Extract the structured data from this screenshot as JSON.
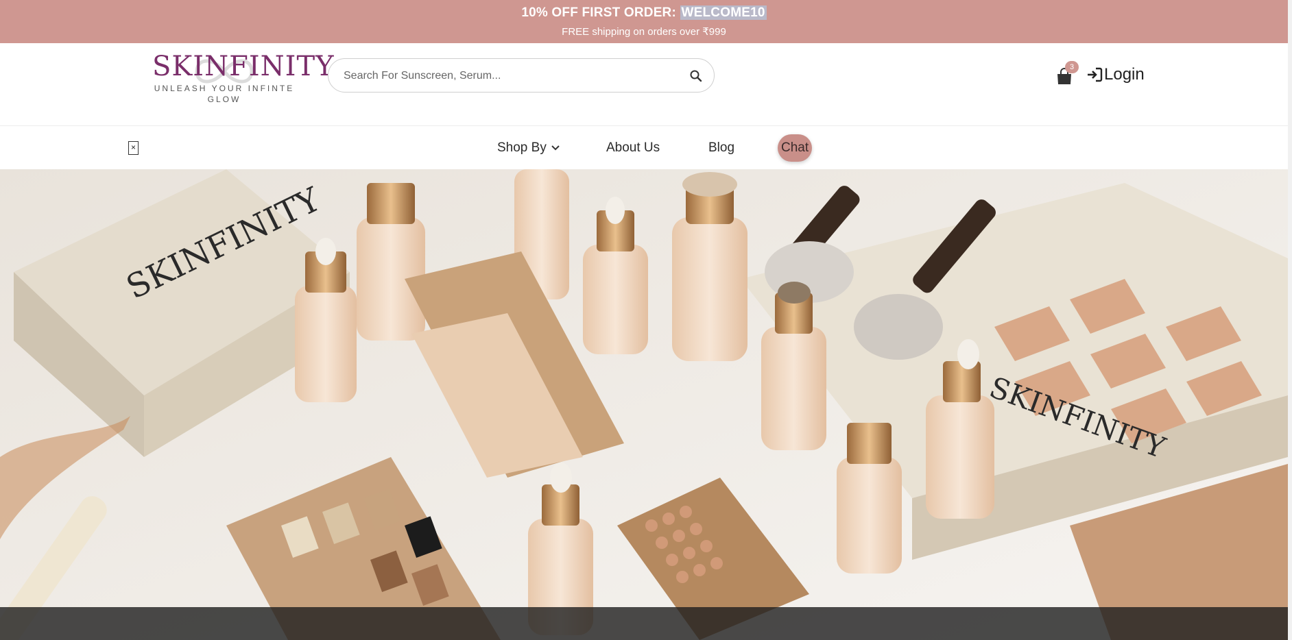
{
  "announcement": {
    "offer_prefix": "10% OFF FIRST ORDER: ",
    "offer_code": "WELCOME10",
    "shipping": "FREE shipping on orders over ₹999"
  },
  "brand": {
    "name": "SKINFINITY",
    "tagline_1": "UNLEASH YOUR INFINTE",
    "tagline_2": "GLOW",
    "color": "#7a2e6a"
  },
  "search": {
    "placeholder": "Search For Sunscreen, Serum...",
    "value": ""
  },
  "cart": {
    "count": "3"
  },
  "login": {
    "label": "Login"
  },
  "nav": {
    "close_label": "×",
    "items": [
      {
        "label": "Shop By",
        "icon": "chevron-down-icon"
      },
      {
        "label": "About Us"
      },
      {
        "label": "Blog"
      },
      {
        "label": "Chat"
      }
    ]
  },
  "hero": {
    "box_label_1": "SKINFINITY",
    "box_label_2": "SKINFINITY"
  },
  "colors": {
    "accent": "#cf9791",
    "chat_bg": "#c98f89",
    "brand": "#7a2e6a"
  }
}
